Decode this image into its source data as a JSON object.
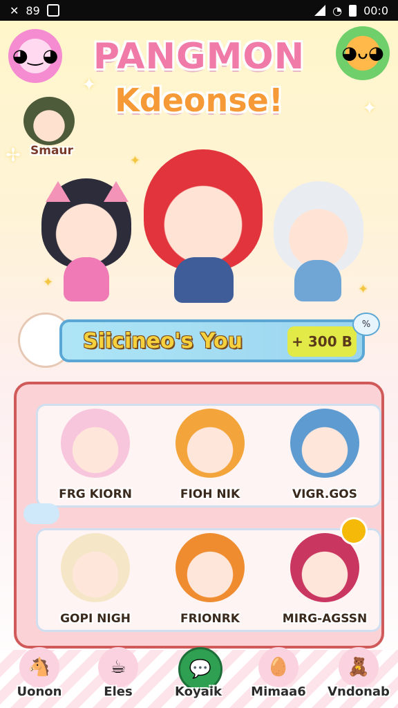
{
  "status_bar": {
    "left_text": "89",
    "time": "00:0"
  },
  "header": {
    "title_line1": "PANGMON",
    "title_line2": "Kdeonse!"
  },
  "side_character": {
    "label": "Smaur"
  },
  "banner": {
    "text": "Siicineo's You",
    "count": "+ 300 B",
    "badge": "%"
  },
  "roster": {
    "row1": [
      {
        "name": "FRG KIORN"
      },
      {
        "name": "FIOH NIK"
      },
      {
        "name": "VIGR.GOS"
      }
    ],
    "row2": [
      {
        "name": "GOPI NIGH"
      },
      {
        "name": "FRIONRK"
      },
      {
        "name": "MIRG-AGSSN"
      }
    ]
  },
  "bottom_nav": {
    "items": [
      {
        "label": "Uonon",
        "icon": "horse-icon"
      },
      {
        "label": "Eles",
        "icon": "cup-icon"
      },
      {
        "label": "Koyaik",
        "icon": "chat-bubble-icon"
      },
      {
        "label": "Mimaa6",
        "icon": "egg-icon"
      },
      {
        "label": "Vndonab",
        "icon": "bear-box-icon"
      }
    ]
  },
  "colors": {
    "accent_pink": "#f07aa8",
    "accent_orange": "#f59a36",
    "panel_border": "#d05a5a",
    "banner_blue": "#5aa7d6"
  }
}
